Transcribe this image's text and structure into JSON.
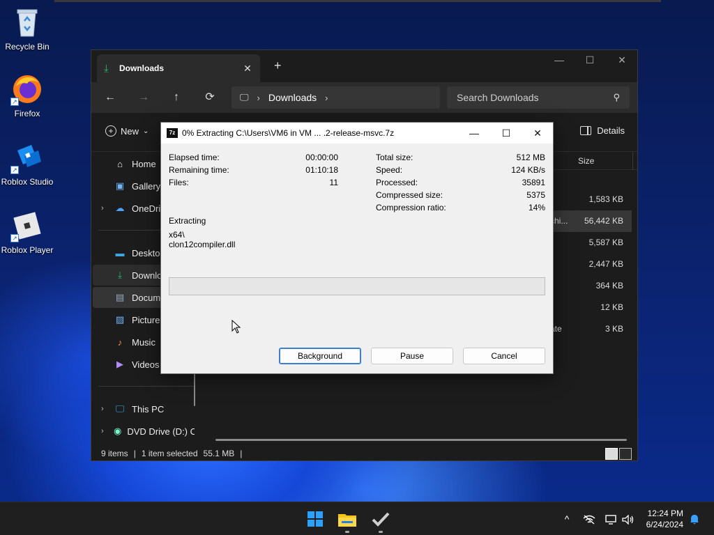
{
  "desktop": {
    "icons": [
      {
        "label": "Recycle Bin",
        "icon": "recycle-bin-icon"
      },
      {
        "label": "Firefox",
        "icon": "firefox-icon"
      },
      {
        "label": "Roblox Studio",
        "icon": "roblox-studio-icon"
      },
      {
        "label": "Roblox Player",
        "icon": "roblox-player-icon"
      }
    ]
  },
  "explorer": {
    "tab": {
      "title": "Downloads",
      "icon": "download-icon"
    },
    "new_tab_glyph": "+",
    "window_controls": {
      "minimize": "—",
      "maximize": "☐",
      "close": "✕"
    },
    "nav": {
      "back": "←",
      "forward": "→",
      "up": "↑",
      "refresh": "⟳"
    },
    "address": {
      "crumb": "Downloads"
    },
    "search": {
      "placeholder": "Search Downloads"
    },
    "cmdbar": {
      "new_label": "New",
      "details_label": "Details"
    },
    "sidebar": {
      "items": [
        {
          "label": "Home",
          "icon": "home-icon"
        },
        {
          "label": "Gallery",
          "icon": "gallery-icon"
        },
        {
          "label": "OneDrive",
          "icon": "onedrive-icon"
        },
        {
          "label": "Desktop",
          "icon": "desktop-icon"
        },
        {
          "label": "Downloads",
          "icon": "download-icon"
        },
        {
          "label": "Documents",
          "icon": "documents-icon"
        },
        {
          "label": "Pictures",
          "icon": "pictures-icon"
        },
        {
          "label": "Music",
          "icon": "music-icon"
        },
        {
          "label": "Videos",
          "icon": "videos-icon"
        },
        {
          "label": "This PC",
          "icon": "pc-icon"
        },
        {
          "label": "DVD Drive (D:) C",
          "icon": "dvd-icon"
        }
      ]
    },
    "columns": {
      "size": "Size"
    },
    "files": [
      {
        "type": "",
        "size": "1,583 KB"
      },
      {
        "type": "chi...",
        "size": "56,442 KB"
      },
      {
        "type": "",
        "size": "5,587 KB"
      },
      {
        "type": "",
        "size": "2,447 KB"
      },
      {
        "type": "",
        "size": "364 KB"
      },
      {
        "type": "",
        "size": "12 KB"
      },
      {
        "type": "ate",
        "size": "3 KB"
      }
    ],
    "status": {
      "items": "9 items",
      "selected": "1 item selected",
      "size": "55.1 MB"
    }
  },
  "dialog": {
    "title": "0% Extracting C:\\Users\\VM6 in VM ... .2-release-msvc.7z",
    "app_icon_text": "7z",
    "left_stats": [
      {
        "label": "Elapsed time:",
        "value": "00:00:00"
      },
      {
        "label": "Remaining time:",
        "value": "01:10:18"
      },
      {
        "label": "Files:",
        "value": "11"
      }
    ],
    "right_stats": [
      {
        "label": "Total size:",
        "value": "512 MB"
      },
      {
        "label": "Speed:",
        "value": "124 KB/s"
      },
      {
        "label": "Processed:",
        "value": "35891"
      },
      {
        "label": "Compressed size:",
        "value": "5375"
      },
      {
        "label": "Compression ratio:",
        "value": "14%"
      }
    ],
    "operation": "Extracting",
    "current_dir": "x64\\",
    "current_file": "clon12compiler.dll",
    "progress": 0,
    "buttons": {
      "background": "Background",
      "pause": "Pause",
      "cancel": "Cancel"
    }
  },
  "taskbar": {
    "apps": [
      "windows-start-icon",
      "file-explorer-icon",
      "checkmark-app-icon"
    ],
    "tray": {
      "chevron": "^"
    },
    "clock": {
      "time": "12:24 PM",
      "date": "6/24/2024"
    }
  }
}
